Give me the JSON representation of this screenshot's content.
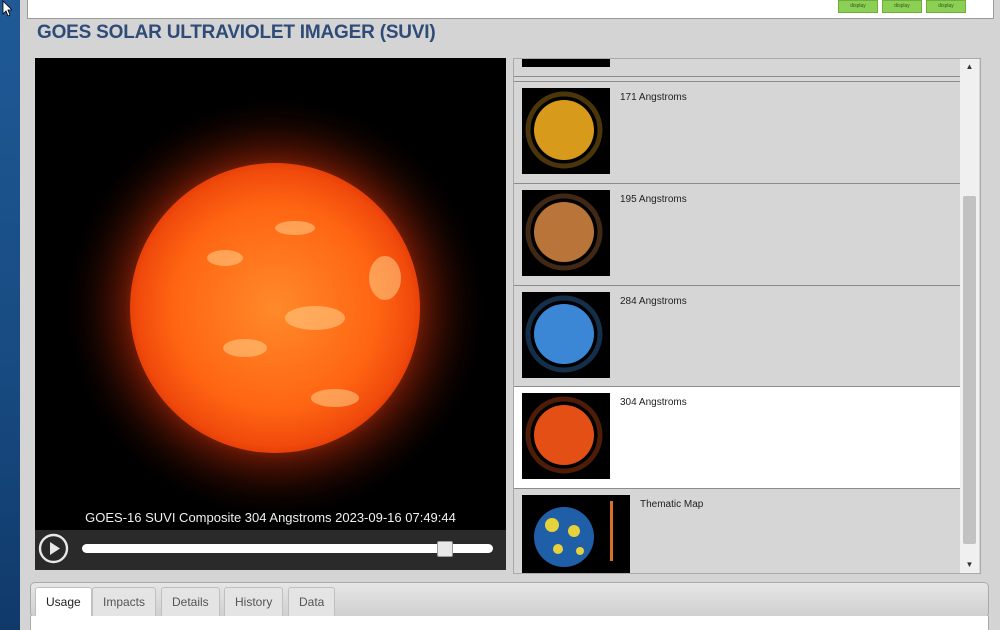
{
  "page": {
    "title": "GOES SOLAR ULTRAVIOLET IMAGER (SUVI)",
    "top_buttons": [
      "display",
      "display",
      "display"
    ]
  },
  "viewer": {
    "caption": "GOES-16 SUVI Composite 304 Angstroms 2023-09-16 07:49:44",
    "slider_fraction": 0.88,
    "play_icon": "play-circle-icon"
  },
  "thumbnails": {
    "items": [
      {
        "label": "171 Angstroms",
        "color": "#d89a1a"
      },
      {
        "label": "195 Angstroms",
        "color": "#b9743a"
      },
      {
        "label": "284 Angstroms",
        "color": "#3c86d6"
      },
      {
        "label": "304 Angstroms",
        "color": "#e34f14"
      },
      {
        "label": "Thematic Map",
        "color": "#1e5fa8"
      }
    ],
    "selected_index": 3
  },
  "tabs": [
    "Usage",
    "Impacts",
    "Details",
    "History",
    "Data"
  ],
  "active_tab": "Usage",
  "colors": {
    "title": "#2f4b78",
    "button_green": "#8ccf55",
    "sun_core": "#ff6a10"
  }
}
